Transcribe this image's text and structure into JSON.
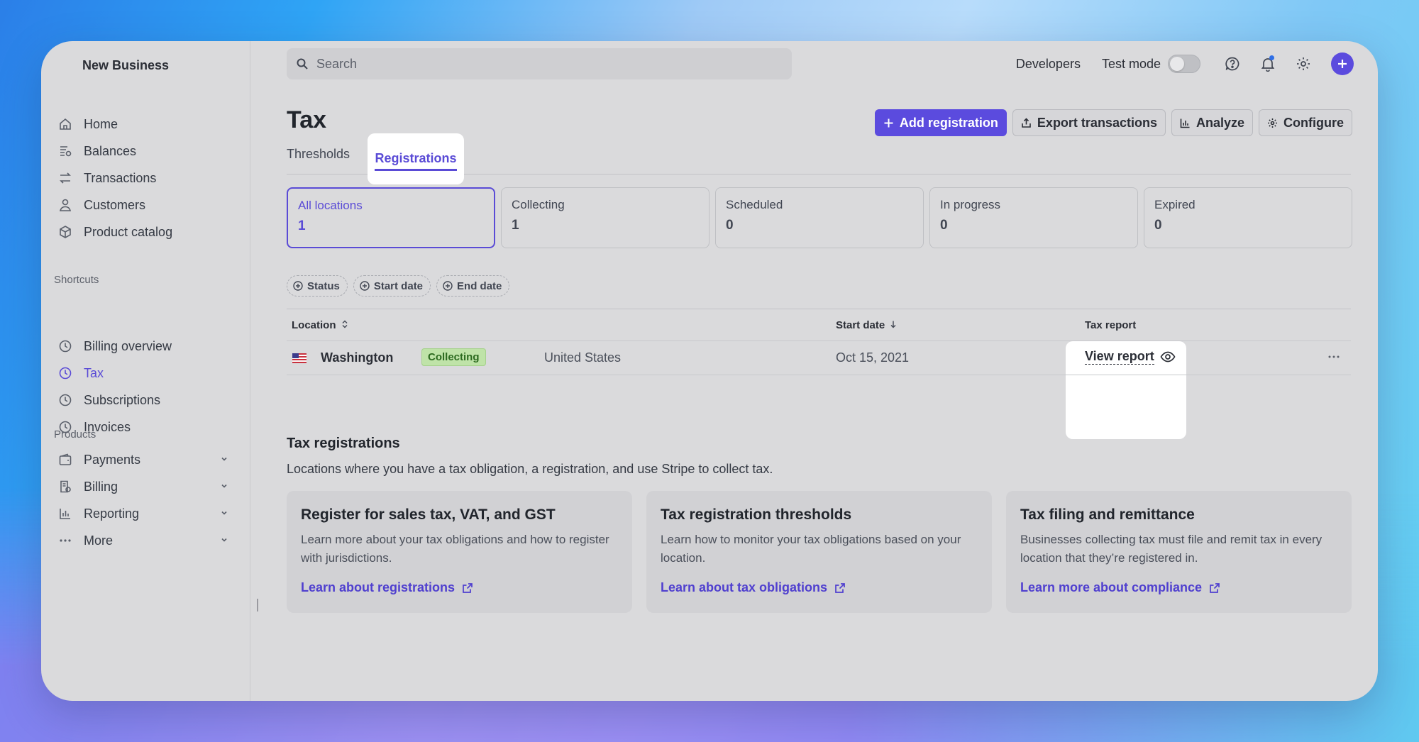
{
  "sidebar": {
    "business_name": "New Business",
    "main_items": [
      {
        "label": "Home",
        "icon": "home-icon"
      },
      {
        "label": "Balances",
        "icon": "balances-icon"
      },
      {
        "label": "Transactions",
        "icon": "transactions-icon"
      },
      {
        "label": "Customers",
        "icon": "customers-icon"
      },
      {
        "label": "Product catalog",
        "icon": "product-catalog-icon"
      }
    ],
    "shortcuts_label": "Shortcuts",
    "shortcuts": [
      {
        "label": "Billing overview",
        "icon": "clock-icon"
      },
      {
        "label": "Tax",
        "icon": "clock-icon",
        "active": true
      },
      {
        "label": "Subscriptions",
        "icon": "clock-icon"
      },
      {
        "label": "Invoices",
        "icon": "clock-icon"
      }
    ],
    "products_label": "Products",
    "products": [
      {
        "label": "Payments",
        "icon": "payments-icon"
      },
      {
        "label": "Billing",
        "icon": "billing-icon"
      },
      {
        "label": "Reporting",
        "icon": "reporting-icon"
      },
      {
        "label": "More",
        "icon": "more-icon"
      }
    ]
  },
  "topbar": {
    "search_placeholder": "Search",
    "developers": "Developers",
    "test_mode": "Test mode"
  },
  "page": {
    "title": "Tax",
    "actions": {
      "add_registration": "Add registration",
      "export_transactions": "Export transactions",
      "analyze": "Analyze",
      "configure": "Configure"
    },
    "tabs": [
      "Thresholds",
      "Registrations"
    ],
    "filter_cards": [
      {
        "label": "All locations",
        "count": "1"
      },
      {
        "label": "Collecting",
        "count": "1"
      },
      {
        "label": "Scheduled",
        "count": "0"
      },
      {
        "label": "In progress",
        "count": "0"
      },
      {
        "label": "Expired",
        "count": "0"
      }
    ],
    "filter_chips": [
      "Status",
      "Start date",
      "End date"
    ]
  },
  "table": {
    "headers": {
      "location": "Location",
      "start_date": "Start date",
      "tax_report": "Tax report"
    },
    "rows": [
      {
        "location": "Washington",
        "status": "Collecting",
        "country": "United States",
        "start_date": "Oct 15, 2021",
        "report": "View report"
      }
    ]
  },
  "registrations_section": {
    "title": "Tax registrations",
    "description": "Locations where you have a tax obligation, a registration, and use Stripe to collect tax.",
    "cards": [
      {
        "title": "Register for sales tax, VAT, and GST",
        "body": "Learn more about your tax obligations and how to register with jurisdictions.",
        "link": "Learn about registrations"
      },
      {
        "title": "Tax registration thresholds",
        "body": "Learn how to monitor your tax obligations based on your location.",
        "link": "Learn about tax obligations"
      },
      {
        "title": "Tax filing and remittance",
        "body": "Businesses collecting tax must file and remit tax in every location that they’re registered in.",
        "link": "Learn more about compliance"
      }
    ]
  },
  "colors": {
    "accent": "#5b4bde",
    "badge_bg": "#bfe3a8"
  }
}
